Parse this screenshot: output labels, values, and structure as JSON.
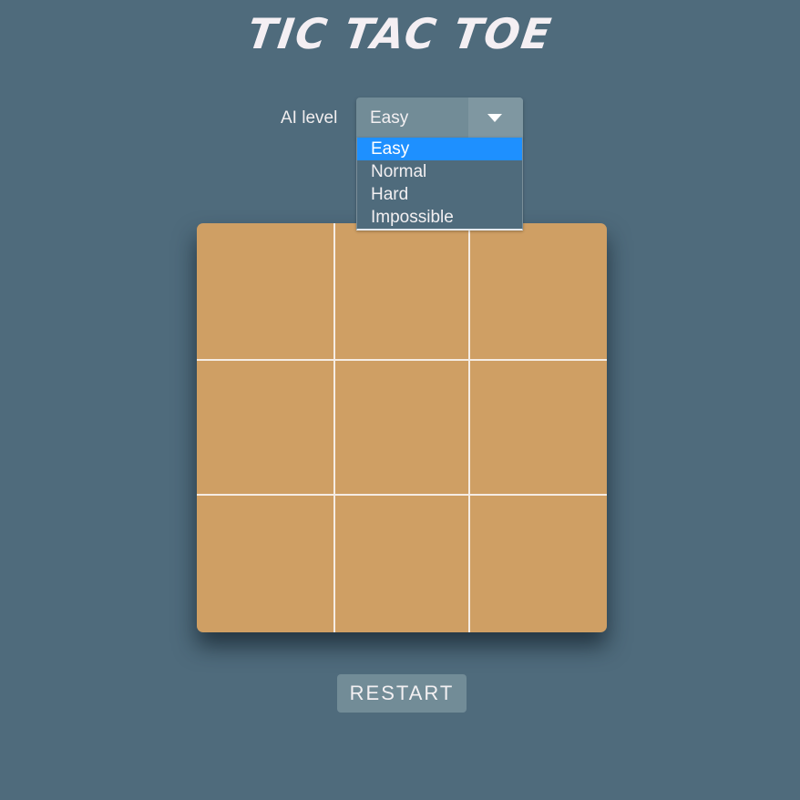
{
  "header": {
    "title": "TIC TAC TOE"
  },
  "ai_level": {
    "label": "AI level",
    "selected": "Easy",
    "options": [
      "Easy",
      "Normal",
      "Hard",
      "Impossible"
    ],
    "highlighted_index": 0,
    "dropdown_open": true
  },
  "board": {
    "cells": [
      "",
      "",
      "",
      "",
      "",
      "",
      "",
      "",
      ""
    ]
  },
  "controls": {
    "restart_label": "RESTART"
  },
  "colors": {
    "background": "#4f6b7c",
    "board": "#cf9f64",
    "highlight": "#1e90ff"
  }
}
